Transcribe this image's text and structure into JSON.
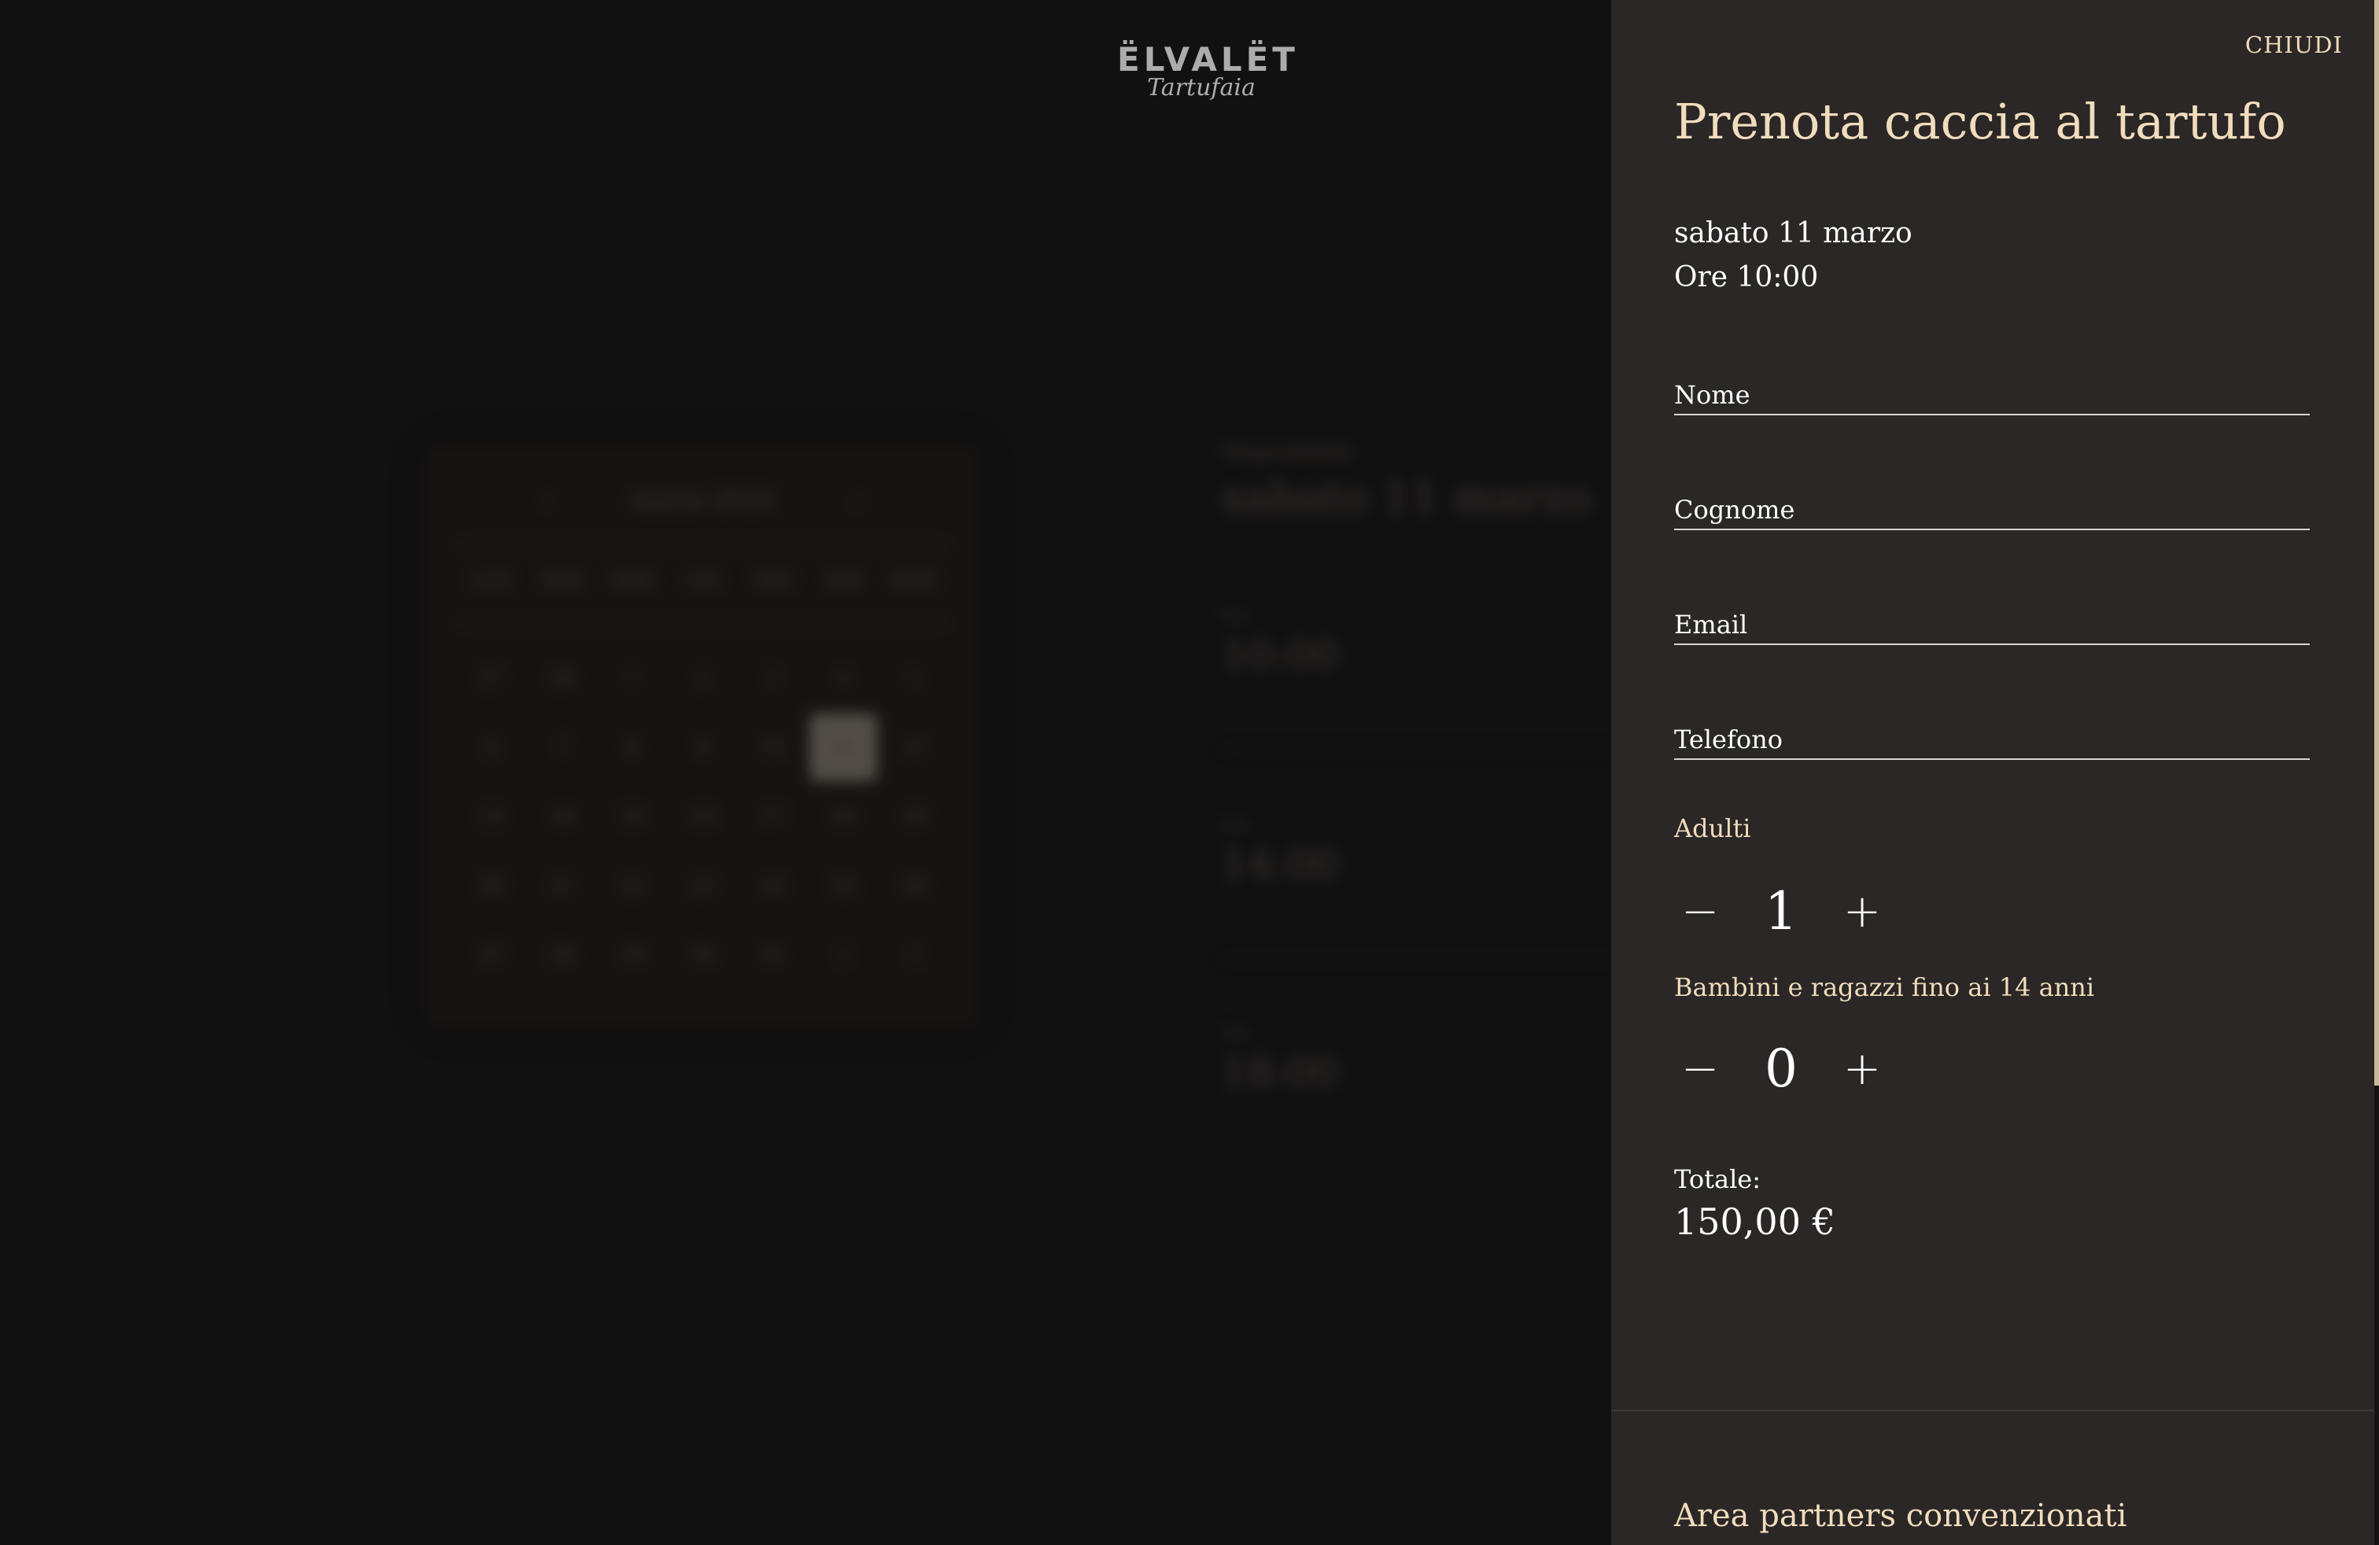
{
  "logo": {
    "main": "ËLVALËT",
    "sub": "Tartufaia"
  },
  "calendar": {
    "prev_icon": "‹",
    "next_icon": "›",
    "month": "marzo 2023",
    "weekdays": [
      "LUN",
      "MAR",
      "MER",
      "GIO",
      "VEN",
      "SAB",
      "DOM"
    ],
    "days": [
      "27",
      "28",
      "1",
      "2",
      "3",
      "4",
      "5",
      "6",
      "7",
      "8",
      "9",
      "10",
      "11",
      "12",
      "13",
      "14",
      "15",
      "16",
      "17",
      "18",
      "19",
      "20",
      "21",
      "22",
      "23",
      "24",
      "25",
      "26",
      "27",
      "28",
      "29",
      "30",
      "31",
      "1",
      "2"
    ],
    "selected_day": "11"
  },
  "availability": {
    "label": "Disponibilità",
    "date": "sabato 11 marzo",
    "slots": [
      {
        "label": "Ore",
        "time": "10:00"
      },
      {
        "label": "Ore",
        "time": "14:00"
      },
      {
        "label": "Ore",
        "time": "18:00"
      }
    ]
  },
  "booking": {
    "close_label": "CHIUDI",
    "title": "Prenota caccia al tartufo",
    "date": "sabato 11 marzo",
    "time": "Ore 10:00",
    "fields": {
      "first_name": {
        "placeholder": "Nome",
        "value": ""
      },
      "last_name": {
        "placeholder": "Cognome",
        "value": ""
      },
      "email": {
        "placeholder": "Email",
        "value": ""
      },
      "phone": {
        "placeholder": "Telefono",
        "value": ""
      }
    },
    "adults": {
      "label": "Adulti",
      "value": "1",
      "minus": "−",
      "plus": "+"
    },
    "children": {
      "label": "Bambini e ragazzi fino ai 14 anni",
      "value": "0",
      "minus": "−",
      "plus": "+"
    },
    "total_label": "Totale:",
    "total_value": "150,00 €",
    "partners_link": "Area partners convenzionati"
  },
  "colors": {
    "background": "#121111",
    "panel": "#2a2726",
    "accent": "#f1dcbc"
  }
}
